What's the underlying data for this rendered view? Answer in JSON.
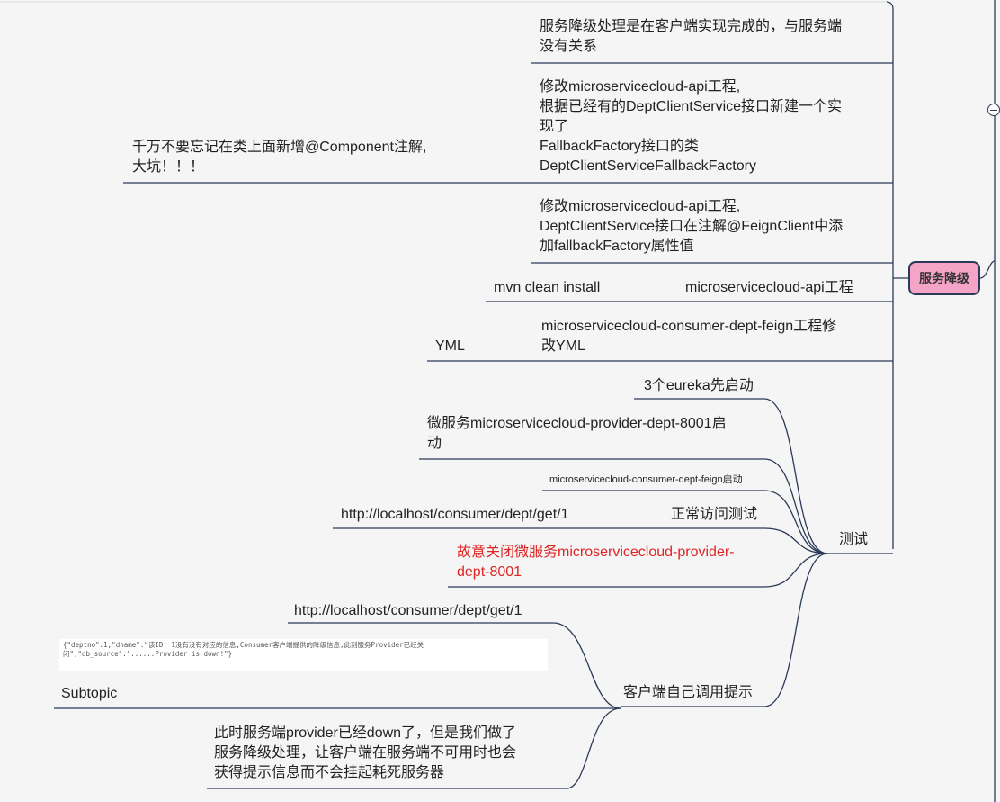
{
  "central": "服务降级",
  "branches": {
    "b1": [
      "服务降级处理是在客户端实现完成的，与服务端",
      "没有关系"
    ],
    "b2": [
      "修改microservicecloud-api工程,",
      "根据已经有的DeptClientService接口新建一个实",
      "现了",
      "FallbackFactory接口的类",
      "DeptClientServiceFallbackFactory"
    ],
    "b2_child": [
      "千万不要忘记在类上面新增@Component注解,",
      "大坑！！！"
    ],
    "b3": [
      "修改microservicecloud-api工程,",
      "DeptClientService接口在注解@FeignClient中添",
      "加fallbackFactory属性值"
    ],
    "b4": "microservicecloud-api工程",
    "b4_child": "mvn clean install",
    "b5": [
      "microservicecloud-consumer-dept-feign工程修",
      "改YML"
    ],
    "b5_child": "YML",
    "test": "测试",
    "test_children": {
      "c1": "3个eureka先启动",
      "c2": [
        "微服务microservicecloud-provider-dept-8001启",
        "动"
      ],
      "c3": "microservicecloud-consumer-dept-feign启动",
      "c4": "正常访问测试",
      "c4_child": "http://localhost/consumer/dept/get/1",
      "c5": [
        "故意关闭微服务microservicecloud-provider-",
        "dept-8001"
      ],
      "c6": "客户端自己调用提示",
      "c6_children": {
        "url": "http://localhost/consumer/dept/get/1",
        "json": "{\"deptno\":1,\"dname\":\"该ID: 1没有没有对应的信息,Consumer客户端提供的降级信息,此刻服务Provider已经关闭\",\"db_source\":\"......Provider is down!\"}",
        "subtopic": "Subtopic",
        "note": [
          "此时服务端provider已经down了，但是我们做了",
          "服务降级处理，让客户端在服务端不可用时也会",
          "获得提示信息而不会挂起耗死服务器"
        ]
      }
    }
  },
  "colors": {
    "line": "#2c3a57",
    "central_fill": "#f5a3c7",
    "red_text": "#e02424"
  }
}
